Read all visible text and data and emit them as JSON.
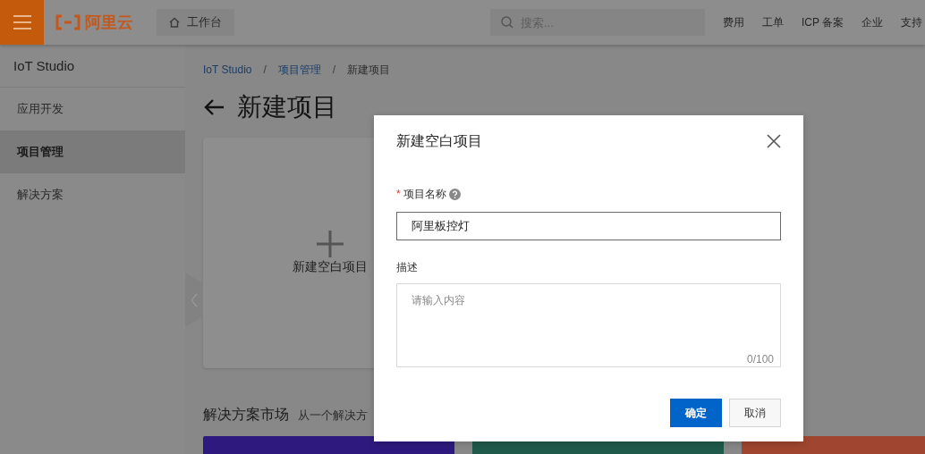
{
  "header": {
    "logo": "阿里云",
    "workbench": "工作台",
    "search": {
      "placeholder": "搜索..."
    },
    "nav": [
      "费用",
      "工单",
      "ICP 备案",
      "企业",
      "支持"
    ]
  },
  "sidebar": {
    "title": "IoT Studio",
    "items": [
      {
        "label": "应用开发",
        "selected": false
      },
      {
        "label": "项目管理",
        "selected": true
      },
      {
        "label": "解决方案",
        "selected": false
      }
    ]
  },
  "breadcrumb": {
    "items": [
      {
        "label": "IoT Studio",
        "link": true
      },
      {
        "label": "项目管理",
        "link": true
      },
      {
        "label": "新建项目",
        "link": false
      }
    ],
    "separators": [
      "/",
      "/"
    ]
  },
  "page_title": "新建项目",
  "new_project_card": {
    "label": "新建空白项目"
  },
  "solutions": {
    "title": "解决方案市场",
    "subtitle": "从一个解决方",
    "cards": [
      {
        "color": "#2e1a7e"
      },
      {
        "color": "#1f5a4a"
      },
      {
        "color": "#a04630"
      }
    ]
  },
  "dialog": {
    "title": "新建空白项目",
    "fields": [
      {
        "kind": "input",
        "label": "项目名称",
        "required_mark": "*",
        "help": true,
        "value": "阿里板控灯"
      },
      {
        "kind": "textarea",
        "label": "描述",
        "placeholder": "请输入内容",
        "counter": "0/100"
      }
    ],
    "buttons": [
      {
        "label": "确定",
        "primary": true
      },
      {
        "label": "取消",
        "primary": false
      }
    ]
  }
}
